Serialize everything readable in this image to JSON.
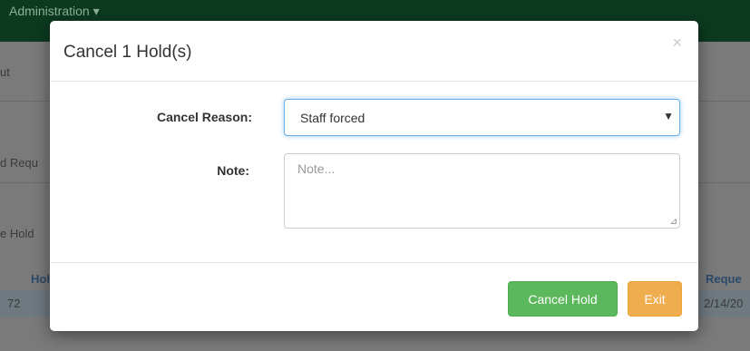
{
  "background": {
    "nav_menu": "Administration ▾",
    "fragments": {
      "partial_1": "ut",
      "partial_2": "d Requ",
      "partial_3": "e Hold",
      "col_hold": "Hol",
      "cell_hold": "72",
      "col_request": "Reque",
      "cell_request": "2/14/20"
    }
  },
  "modal": {
    "title": "Cancel 1 Hold(s)",
    "close_glyph": "×",
    "cancel_reason": {
      "label": "Cancel Reason:",
      "value": "Staff forced",
      "caret": "▼"
    },
    "note": {
      "label": "Note:",
      "placeholder": "Note..."
    },
    "buttons": {
      "cancel_hold": "Cancel Hold",
      "exit": "Exit"
    }
  }
}
